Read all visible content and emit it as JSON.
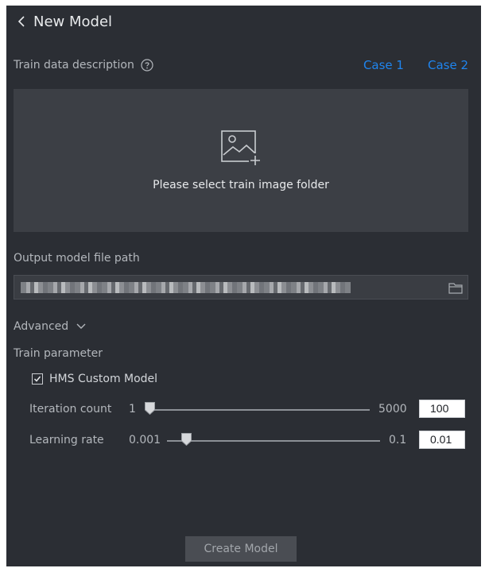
{
  "header": {
    "title": "New Model",
    "back_icon": "chevron-left-icon"
  },
  "train_data": {
    "label": "Train data description",
    "help_icon": "question-circle-icon",
    "case_links": [
      "Case 1",
      "Case 2"
    ],
    "link_color": "#1f85ef"
  },
  "dropzone": {
    "icon": "add-image-icon",
    "text": "Please select train image folder"
  },
  "output": {
    "label": "Output model file path",
    "folder_icon": "folder-icon"
  },
  "advanced": {
    "label": "Advanced",
    "icon": "chevron-down-icon"
  },
  "train_parameter": {
    "label": "Train parameter",
    "custom_model": {
      "label": "HMS Custom Model",
      "checked": true
    },
    "iteration": {
      "label": "Iteration count",
      "min": "1",
      "max": "5000",
      "value": "100"
    },
    "learning_rate": {
      "label": "Learning rate",
      "min": "0.001",
      "max": "0.1",
      "value": "0.01"
    }
  },
  "footer": {
    "create_label": "Create Model"
  },
  "colors": {
    "panel_bg": "#2b2e34",
    "dropzone_bg": "#3c3f45",
    "accent": "#1f85ef"
  }
}
